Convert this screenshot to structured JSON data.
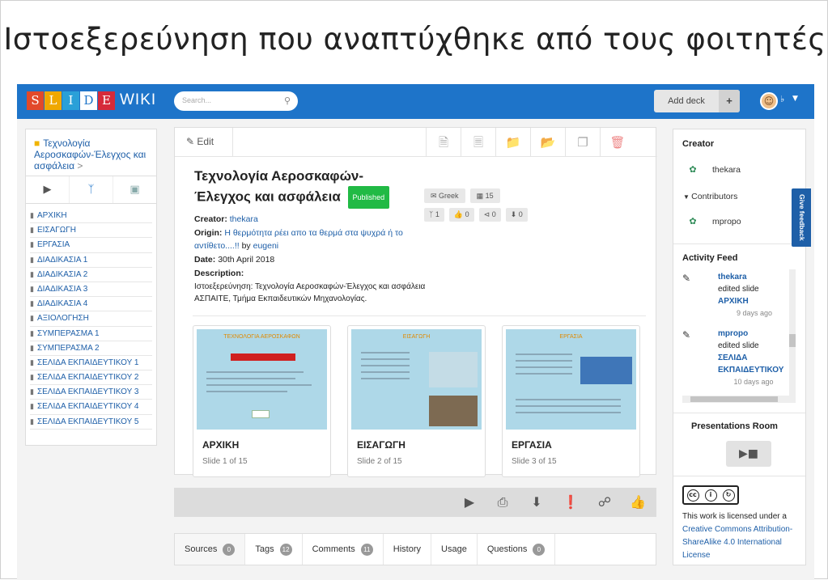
{
  "slide_title": "Ιστοεξερεύνηση που αναπτύχθηκε από τους φοιτητές",
  "header": {
    "logo_letters": [
      "S",
      "L",
      "I",
      "D",
      "E"
    ],
    "logo_colors": [
      "#e2492a",
      "#f0a800",
      "#2aa0d8",
      "#ffffff",
      "#d62a3a"
    ],
    "logo_wiki": "WIKI",
    "search_placeholder": "Search...",
    "add_deck_label": "Add deck",
    "add_deck_plus": "+"
  },
  "left_panel": {
    "deck_title": "Τεχνολογία Αεροσκαφών-Έλεγχος και ασφάλεια",
    "deck_title_arrow": ">",
    "items": [
      "ΑΡΧΙΚΗ",
      "ΕΙΣΑΓΩΓΗ",
      "ΕΡΓΑΣΙΑ",
      "ΔΙΑΔΙΚΑΣΙΑ 1",
      "ΔΙΑΔΙΚΑΣΙΑ 2",
      "ΔΙΑΔΙΚΑΣΙΑ 3",
      "ΔΙΑΔΙΚΑΣΙΑ 4",
      "ΑΞΙΟΛΟΓΗΣΗ",
      "ΣΥΜΠΕΡΑΣΜΑ 1",
      "ΣΥΜΠΕΡΑΣΜΑ 2",
      "ΣΕΛΙΔΑ ΕΚΠΑΙΔΕΥΤΙΚΟΥ 1",
      "ΣΕΛΙΔΑ ΕΚΠΑΙΔΕΥΤΙΚΟΥ 2",
      "ΣΕΛΙΔΑ ΕΚΠΑΙΔΕΥΤΙΚΟΥ 3",
      "ΣΕΛΙΔΑ ΕΚΠΑΙΔΕΥΤΙΚΟΥ 4",
      "ΣΕΛΙΔΑ ΕΚΠΑΙΔΕΥΤΙΚΟΥ 5"
    ]
  },
  "deck": {
    "edit_label": "Edit",
    "title": "Τεχνολογία Αεροσκαφών-Έλεγχος και ασφάλεια",
    "published_label": "Published",
    "language": "Greek",
    "slide_count": "15",
    "forks": "1",
    "likes": "0",
    "shares": "0",
    "downloads": "0",
    "creator_label": "Creator:",
    "creator": "thekara",
    "origin_label": "Origin:",
    "origin_link": "Η θερμότητα ρέει απο τα θερμά στα ψυχρά ή το αντίθετο....!!",
    "origin_by": "by",
    "origin_user": "eugeni",
    "date_label": "Date:",
    "date": "30th April 2018",
    "description_label": "Description:",
    "description": "Ιστοεξερεύνηση: Τεχνολογία Αεροσκαφών-Έλεγχος και ασφάλεια ΑΣΠΑΙΤΕ, Τμήμα Εκπαιδευτικών Μηχανολογίας."
  },
  "cards": [
    {
      "title": "ΑΡΧΙΚΗ",
      "sub": "Slide 1 of 15",
      "thumb_title": "ΤΕΧΝΟΛΟΓΙΑ ΑΕΡΟΣΚΑΦΩΝ"
    },
    {
      "title": "ΕΙΣΑΓΩΓΗ",
      "sub": "Slide 2 of 15",
      "thumb_title": "ΕΙΣΑΓΩΓΗ"
    },
    {
      "title": "ΕΡΓΑΣΙΑ",
      "sub": "Slide 3 of 15",
      "thumb_title": "ΕΡΓΑΣΙΑ"
    }
  ],
  "tabs": [
    {
      "label": "Sources",
      "count": "0"
    },
    {
      "label": "Tags",
      "count": "12"
    },
    {
      "label": "Comments",
      "count": "11"
    },
    {
      "label": "History",
      "count": ""
    },
    {
      "label": "Usage",
      "count": ""
    },
    {
      "label": "Questions",
      "count": "0"
    }
  ],
  "right_panel": {
    "creator_heading": "Creator",
    "creator_name": "thekara",
    "contributors_label": "Contributors",
    "contributor_name": "mpropo",
    "activity_heading": "Activity Feed",
    "feed": [
      {
        "user": "thekara",
        "action": "edited slide",
        "target": "ΑΡΧΙΚΗ",
        "ago": "9 days ago"
      },
      {
        "user": "mpropo",
        "action": "edited slide",
        "target": "ΣΕΛΙΔΑ ΕΚΠΑΙΔΕΥΤΙΚΟΥ",
        "ago": "10 days ago"
      }
    ],
    "presentations_heading": "Presentations Room",
    "license_text": "This work is licensed under a",
    "license_link": "Creative Commons Attribution-ShareAlike 4.0 International License",
    "cc_label": "BY SA"
  },
  "feedback_label": "Give feedback"
}
